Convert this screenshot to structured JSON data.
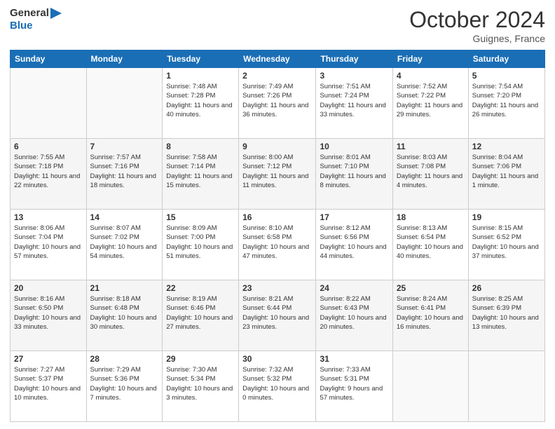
{
  "header": {
    "logo_general": "General",
    "logo_blue": "Blue",
    "month_title": "October 2024",
    "location": "Guignes, France"
  },
  "days_of_week": [
    "Sunday",
    "Monday",
    "Tuesday",
    "Wednesday",
    "Thursday",
    "Friday",
    "Saturday"
  ],
  "weeks": [
    [
      {
        "day": "",
        "sunrise": "",
        "sunset": "",
        "daylight": ""
      },
      {
        "day": "",
        "sunrise": "",
        "sunset": "",
        "daylight": ""
      },
      {
        "day": "1",
        "sunrise": "Sunrise: 7:48 AM",
        "sunset": "Sunset: 7:28 PM",
        "daylight": "Daylight: 11 hours and 40 minutes."
      },
      {
        "day": "2",
        "sunrise": "Sunrise: 7:49 AM",
        "sunset": "Sunset: 7:26 PM",
        "daylight": "Daylight: 11 hours and 36 minutes."
      },
      {
        "day": "3",
        "sunrise": "Sunrise: 7:51 AM",
        "sunset": "Sunset: 7:24 PM",
        "daylight": "Daylight: 11 hours and 33 minutes."
      },
      {
        "day": "4",
        "sunrise": "Sunrise: 7:52 AM",
        "sunset": "Sunset: 7:22 PM",
        "daylight": "Daylight: 11 hours and 29 minutes."
      },
      {
        "day": "5",
        "sunrise": "Sunrise: 7:54 AM",
        "sunset": "Sunset: 7:20 PM",
        "daylight": "Daylight: 11 hours and 26 minutes."
      }
    ],
    [
      {
        "day": "6",
        "sunrise": "Sunrise: 7:55 AM",
        "sunset": "Sunset: 7:18 PM",
        "daylight": "Daylight: 11 hours and 22 minutes."
      },
      {
        "day": "7",
        "sunrise": "Sunrise: 7:57 AM",
        "sunset": "Sunset: 7:16 PM",
        "daylight": "Daylight: 11 hours and 18 minutes."
      },
      {
        "day": "8",
        "sunrise": "Sunrise: 7:58 AM",
        "sunset": "Sunset: 7:14 PM",
        "daylight": "Daylight: 11 hours and 15 minutes."
      },
      {
        "day": "9",
        "sunrise": "Sunrise: 8:00 AM",
        "sunset": "Sunset: 7:12 PM",
        "daylight": "Daylight: 11 hours and 11 minutes."
      },
      {
        "day": "10",
        "sunrise": "Sunrise: 8:01 AM",
        "sunset": "Sunset: 7:10 PM",
        "daylight": "Daylight: 11 hours and 8 minutes."
      },
      {
        "day": "11",
        "sunrise": "Sunrise: 8:03 AM",
        "sunset": "Sunset: 7:08 PM",
        "daylight": "Daylight: 11 hours and 4 minutes."
      },
      {
        "day": "12",
        "sunrise": "Sunrise: 8:04 AM",
        "sunset": "Sunset: 7:06 PM",
        "daylight": "Daylight: 11 hours and 1 minute."
      }
    ],
    [
      {
        "day": "13",
        "sunrise": "Sunrise: 8:06 AM",
        "sunset": "Sunset: 7:04 PM",
        "daylight": "Daylight: 10 hours and 57 minutes."
      },
      {
        "day": "14",
        "sunrise": "Sunrise: 8:07 AM",
        "sunset": "Sunset: 7:02 PM",
        "daylight": "Daylight: 10 hours and 54 minutes."
      },
      {
        "day": "15",
        "sunrise": "Sunrise: 8:09 AM",
        "sunset": "Sunset: 7:00 PM",
        "daylight": "Daylight: 10 hours and 51 minutes."
      },
      {
        "day": "16",
        "sunrise": "Sunrise: 8:10 AM",
        "sunset": "Sunset: 6:58 PM",
        "daylight": "Daylight: 10 hours and 47 minutes."
      },
      {
        "day": "17",
        "sunrise": "Sunrise: 8:12 AM",
        "sunset": "Sunset: 6:56 PM",
        "daylight": "Daylight: 10 hours and 44 minutes."
      },
      {
        "day": "18",
        "sunrise": "Sunrise: 8:13 AM",
        "sunset": "Sunset: 6:54 PM",
        "daylight": "Daylight: 10 hours and 40 minutes."
      },
      {
        "day": "19",
        "sunrise": "Sunrise: 8:15 AM",
        "sunset": "Sunset: 6:52 PM",
        "daylight": "Daylight: 10 hours and 37 minutes."
      }
    ],
    [
      {
        "day": "20",
        "sunrise": "Sunrise: 8:16 AM",
        "sunset": "Sunset: 6:50 PM",
        "daylight": "Daylight: 10 hours and 33 minutes."
      },
      {
        "day": "21",
        "sunrise": "Sunrise: 8:18 AM",
        "sunset": "Sunset: 6:48 PM",
        "daylight": "Daylight: 10 hours and 30 minutes."
      },
      {
        "day": "22",
        "sunrise": "Sunrise: 8:19 AM",
        "sunset": "Sunset: 6:46 PM",
        "daylight": "Daylight: 10 hours and 27 minutes."
      },
      {
        "day": "23",
        "sunrise": "Sunrise: 8:21 AM",
        "sunset": "Sunset: 6:44 PM",
        "daylight": "Daylight: 10 hours and 23 minutes."
      },
      {
        "day": "24",
        "sunrise": "Sunrise: 8:22 AM",
        "sunset": "Sunset: 6:43 PM",
        "daylight": "Daylight: 10 hours and 20 minutes."
      },
      {
        "day": "25",
        "sunrise": "Sunrise: 8:24 AM",
        "sunset": "Sunset: 6:41 PM",
        "daylight": "Daylight: 10 hours and 16 minutes."
      },
      {
        "day": "26",
        "sunrise": "Sunrise: 8:25 AM",
        "sunset": "Sunset: 6:39 PM",
        "daylight": "Daylight: 10 hours and 13 minutes."
      }
    ],
    [
      {
        "day": "27",
        "sunrise": "Sunrise: 7:27 AM",
        "sunset": "Sunset: 5:37 PM",
        "daylight": "Daylight: 10 hours and 10 minutes."
      },
      {
        "day": "28",
        "sunrise": "Sunrise: 7:29 AM",
        "sunset": "Sunset: 5:36 PM",
        "daylight": "Daylight: 10 hours and 7 minutes."
      },
      {
        "day": "29",
        "sunrise": "Sunrise: 7:30 AM",
        "sunset": "Sunset: 5:34 PM",
        "daylight": "Daylight: 10 hours and 3 minutes."
      },
      {
        "day": "30",
        "sunrise": "Sunrise: 7:32 AM",
        "sunset": "Sunset: 5:32 PM",
        "daylight": "Daylight: 10 hours and 0 minutes."
      },
      {
        "day": "31",
        "sunrise": "Sunrise: 7:33 AM",
        "sunset": "Sunset: 5:31 PM",
        "daylight": "Daylight: 9 hours and 57 minutes."
      },
      {
        "day": "",
        "sunrise": "",
        "sunset": "",
        "daylight": ""
      },
      {
        "day": "",
        "sunrise": "",
        "sunset": "",
        "daylight": ""
      }
    ]
  ]
}
